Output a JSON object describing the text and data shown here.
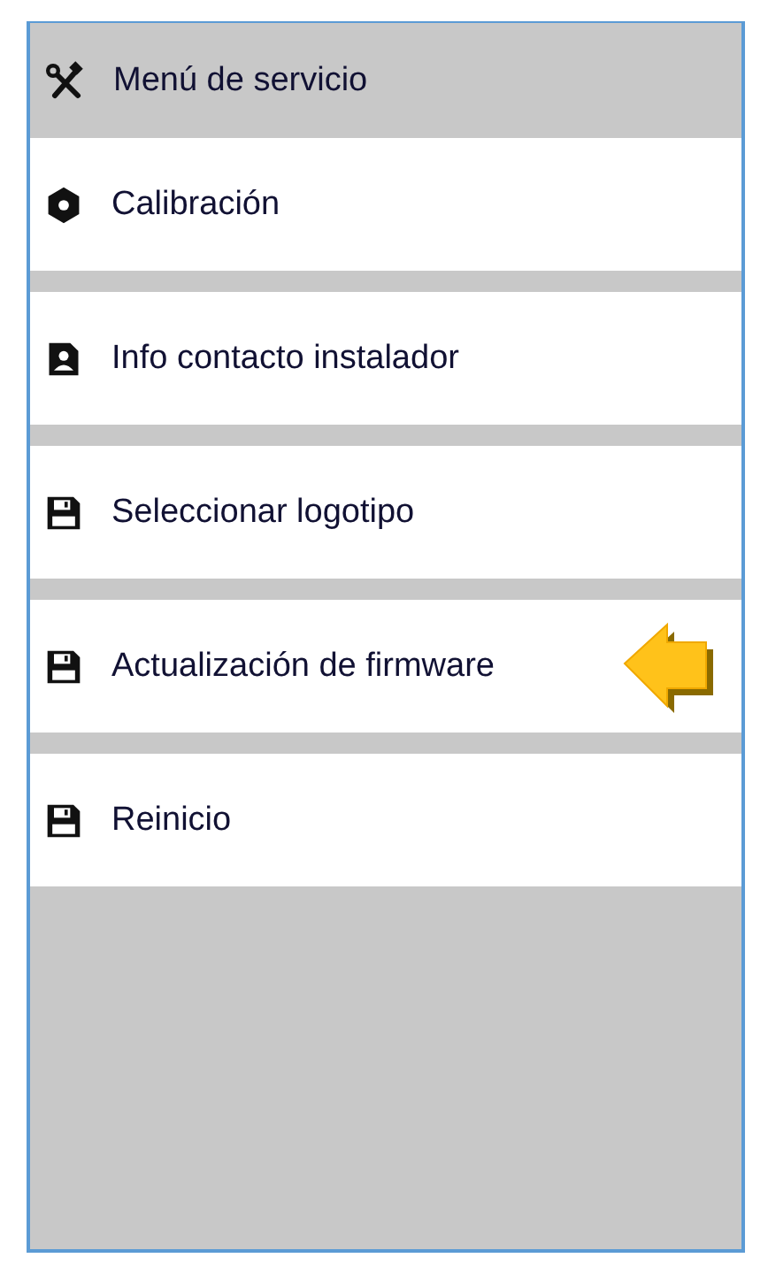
{
  "header": {
    "title": "Menú de servicio"
  },
  "items": [
    {
      "label": "Calibración",
      "kind": "nut",
      "pointed": false
    },
    {
      "label": "Info contacto instalador",
      "kind": "contact",
      "pointed": false
    },
    {
      "label": "Seleccionar logotipo",
      "kind": "floppy",
      "pointed": false
    },
    {
      "label": "Actualización de firmware",
      "kind": "floppy",
      "pointed": true
    },
    {
      "label": "Reinicio",
      "kind": "floppy",
      "pointed": false
    }
  ]
}
